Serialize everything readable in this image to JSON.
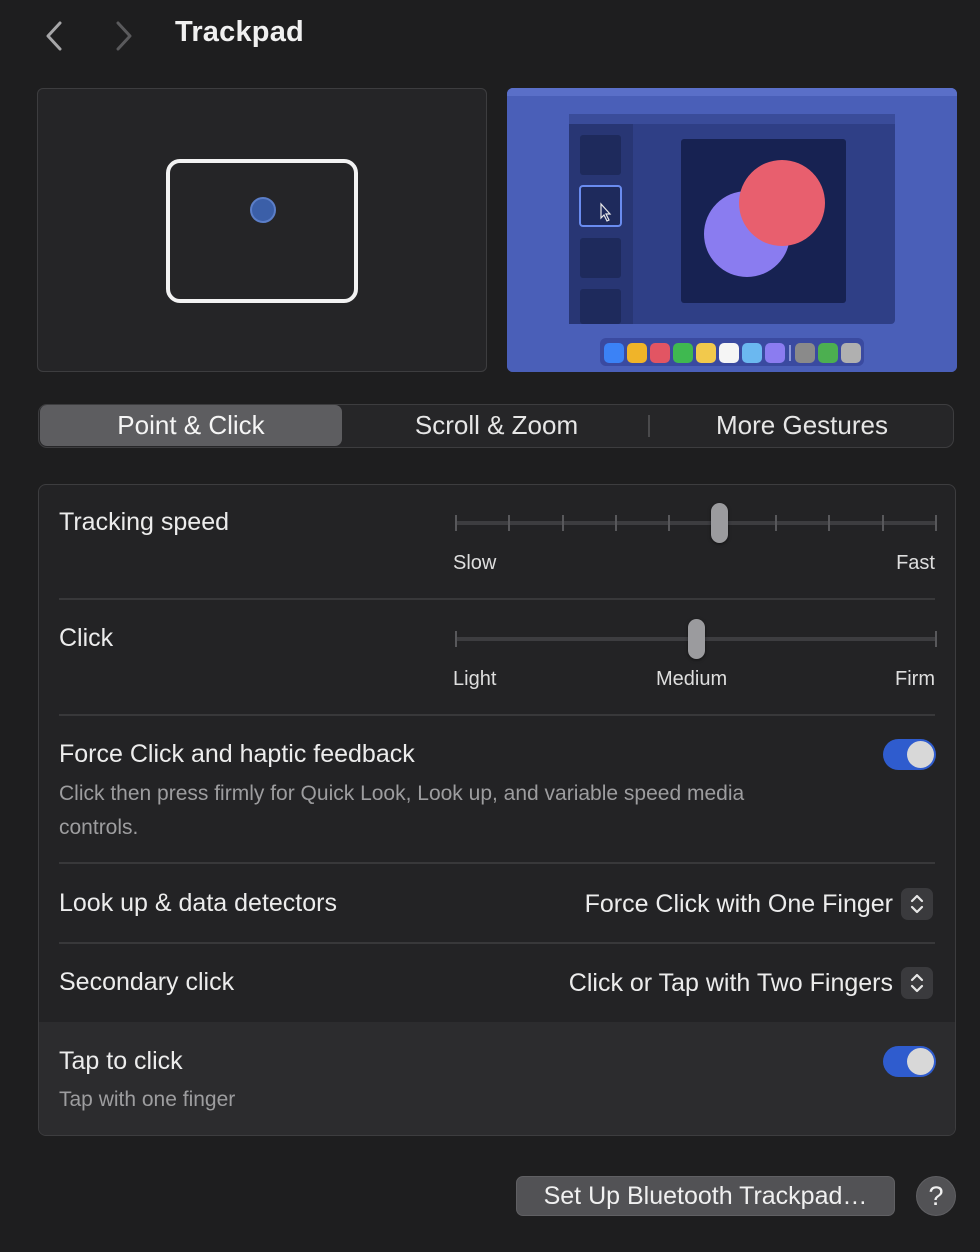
{
  "header": {
    "title": "Trackpad",
    "back_icon": "chevron-left-icon",
    "forward_icon": "chevron-right-icon"
  },
  "preview": {
    "dock_colors": [
      "#3b82f6",
      "#f0b429",
      "#e25563",
      "#3fb950",
      "#f2c94c",
      "#f5f5f5",
      "#6bb8f0",
      "#8b7cf0",
      "#8a8a8a",
      "#4caf50",
      "#b0b0b0"
    ]
  },
  "tabs": [
    {
      "label": "Point & Click",
      "selected": true
    },
    {
      "label": "Scroll & Zoom",
      "selected": false
    },
    {
      "label": "More Gestures",
      "selected": false
    }
  ],
  "settings": {
    "tracking_speed": {
      "label": "Tracking speed",
      "min_label": "Slow",
      "max_label": "Fast",
      "tick_count": 10,
      "value_fraction": 0.55
    },
    "click": {
      "label": "Click",
      "light_label": "Light",
      "medium_label": "Medium",
      "firm_label": "Firm",
      "value_fraction": 0.5
    },
    "force_click": {
      "label": "Force Click and haptic feedback",
      "description": "Click then press firmly for Quick Look, Look up, and variable speed media controls.",
      "enabled": true
    },
    "lookup": {
      "label": "Look up & data detectors",
      "value": "Force Click with One Finger"
    },
    "secondary_click": {
      "label": "Secondary click",
      "value": "Click or Tap with Two Fingers"
    },
    "tap_to_click": {
      "label": "Tap to click",
      "description": "Tap with one finger",
      "enabled": true
    }
  },
  "footer": {
    "bluetooth_button": "Set Up Bluetooth Trackpad…",
    "help_button": "?"
  },
  "colors": {
    "accent": "#2f5cce",
    "background": "#1e1e1f"
  }
}
